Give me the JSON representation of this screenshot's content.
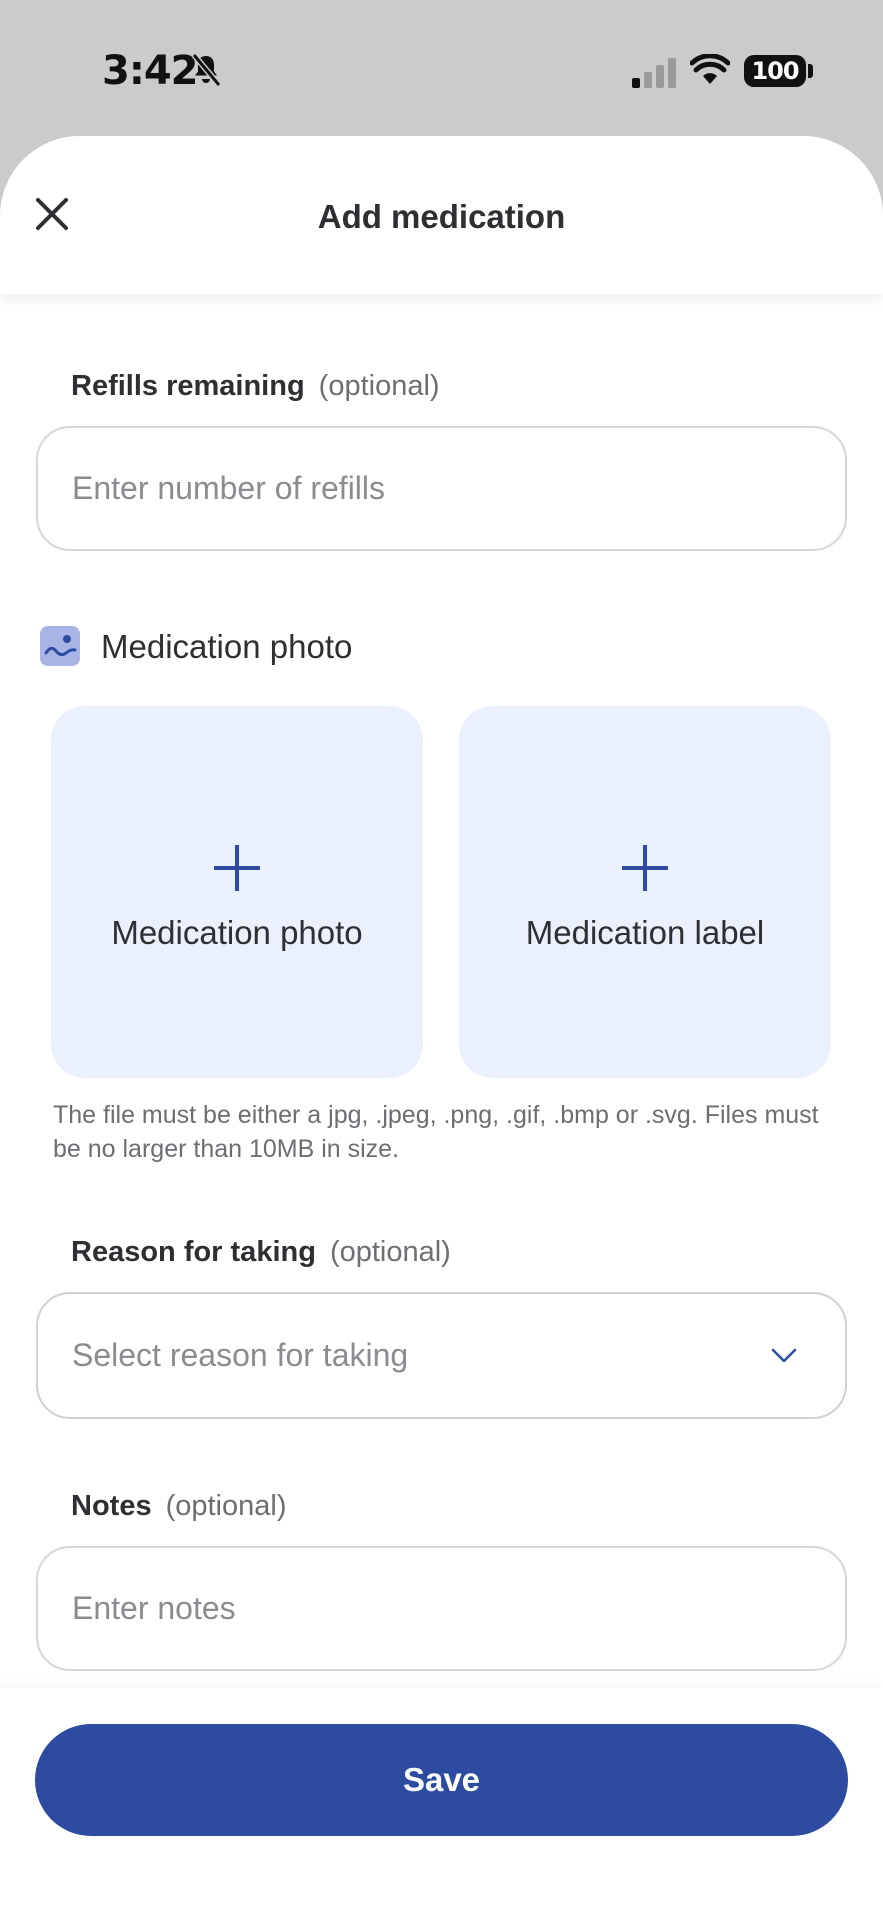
{
  "status_bar": {
    "time": "3:42",
    "battery": "100"
  },
  "header": {
    "title": "Add medication",
    "close_icon": "close-icon"
  },
  "refills": {
    "label": "Refills remaining",
    "optional": "(optional)",
    "placeholder": "Enter number of refills",
    "value": ""
  },
  "medication_photo": {
    "section_title": "Medication photo",
    "section_icon": "image-icon",
    "tiles": [
      {
        "label": "Medication photo",
        "icon": "plus-icon"
      },
      {
        "label": "Medication label",
        "icon": "plus-icon"
      }
    ],
    "hint": "The file must be either a jpg, .jpeg, .png, .gif, .bmp or .svg. Files must be no larger than 10MB in size."
  },
  "reason": {
    "label": "Reason for taking",
    "optional": "(optional)",
    "placeholder": "Select reason for taking",
    "icon": "chevron-down-icon"
  },
  "notes": {
    "label": "Notes",
    "optional": "(optional)",
    "placeholder": "Enter notes",
    "value": ""
  },
  "footer": {
    "save_label": "Save"
  },
  "colors": {
    "primary": "#2d4ba0",
    "tile_background": "#ebf0fd",
    "section_icon": "#a9b4e6"
  }
}
